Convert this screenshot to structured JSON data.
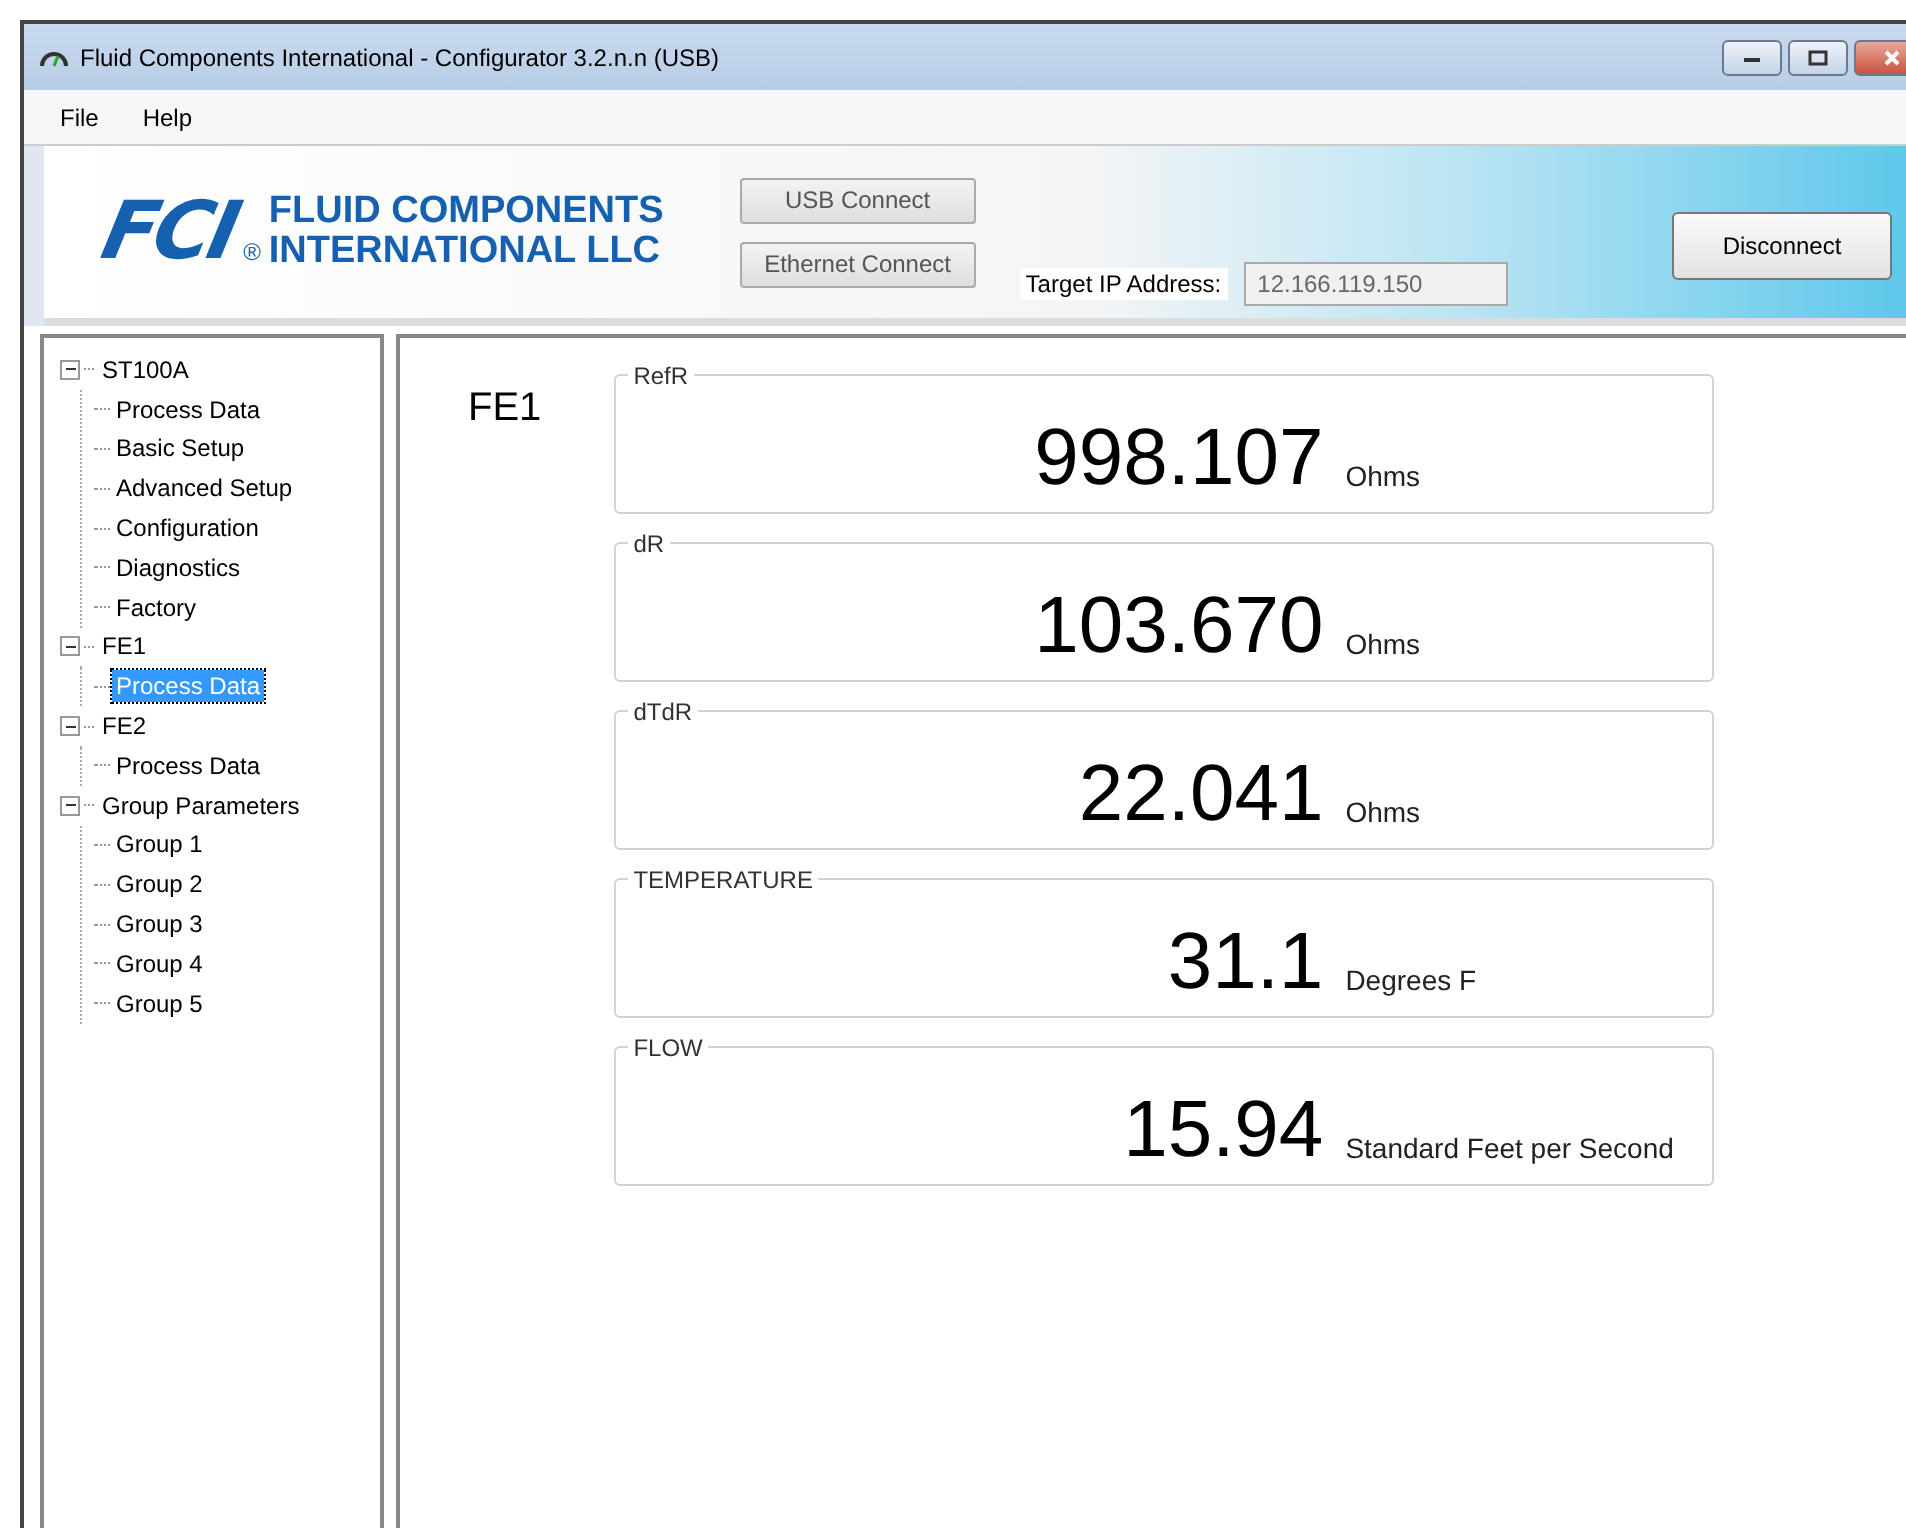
{
  "window": {
    "title": "Fluid Components International - Configurator 3.2.n.n (USB)"
  },
  "menu": [
    "File",
    "Help"
  ],
  "banner": {
    "logo_mark": "FCI",
    "logo_mark_reg": "®",
    "logo_line1": "FLUID COMPONENTS",
    "logo_line2": "INTERNATIONAL LLC",
    "usb_button": "USB Connect",
    "ethernet_button": "Ethernet Connect",
    "ip_label": "Target IP Address:",
    "ip_value": "12.166.119.150",
    "disconnect_button": "Disconnect"
  },
  "tree": [
    {
      "label": "ST100A",
      "expanded": true,
      "children": [
        {
          "label": "Process Data",
          "selected": false
        },
        {
          "label": "Basic Setup",
          "selected": false
        },
        {
          "label": "Advanced Setup",
          "selected": false
        },
        {
          "label": "Configuration",
          "selected": false
        },
        {
          "label": "Diagnostics",
          "selected": false
        },
        {
          "label": "Factory",
          "selected": false
        }
      ]
    },
    {
      "label": "FE1",
      "expanded": true,
      "children": [
        {
          "label": "Process Data",
          "selected": true
        }
      ]
    },
    {
      "label": "FE2",
      "expanded": true,
      "children": [
        {
          "label": "Process Data",
          "selected": false
        }
      ]
    },
    {
      "label": "Group Parameters",
      "expanded": true,
      "children": [
        {
          "label": "Group 1",
          "selected": false
        },
        {
          "label": "Group 2",
          "selected": false
        },
        {
          "label": "Group 3",
          "selected": false
        },
        {
          "label": "Group 4",
          "selected": false
        },
        {
          "label": "Group 5",
          "selected": false
        }
      ]
    }
  ],
  "main": {
    "heading": "FE1",
    "readings": [
      {
        "label": "RefR",
        "value": "998.107",
        "unit": "Ohms"
      },
      {
        "label": "dR",
        "value": "103.670",
        "unit": "Ohms"
      },
      {
        "label": "dTdR",
        "value": "22.041",
        "unit": "Ohms"
      },
      {
        "label": "TEMPERATURE",
        "value": "31.1",
        "unit": "Degrees F"
      },
      {
        "label": "FLOW",
        "value": "15.94",
        "unit": "Standard Feet per Second"
      }
    ]
  }
}
